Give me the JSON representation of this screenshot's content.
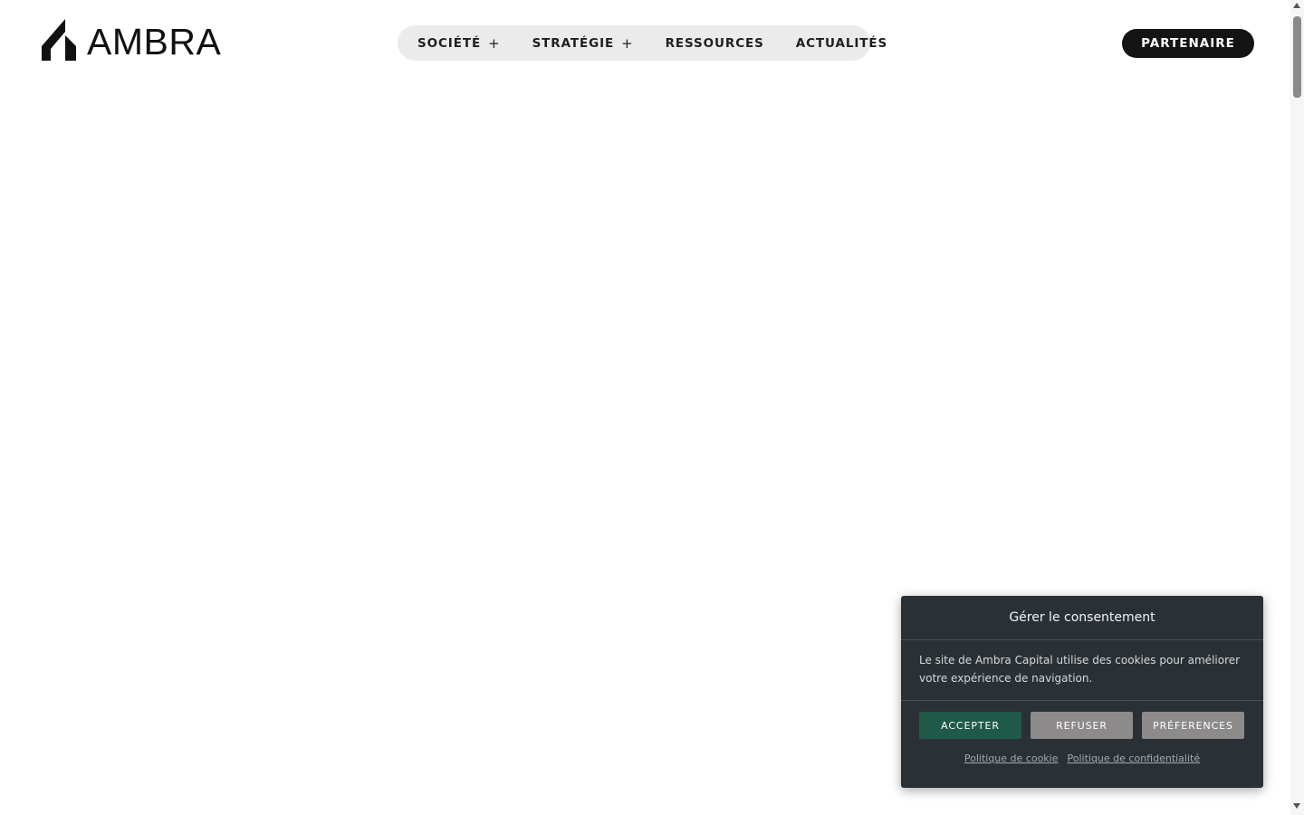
{
  "header": {
    "logo": {
      "text": "AMBRA",
      "icon": "ambra-mark-icon"
    },
    "nav": [
      {
        "label": "SOCIÉTÉ",
        "expand": "+"
      },
      {
        "label": "STRATÉGIE",
        "expand": "+"
      },
      {
        "label": "RESSOURCES"
      },
      {
        "label": "ACTUALITÉS"
      }
    ],
    "partner_label": "PARTENAIRE"
  },
  "cookie": {
    "title": "Gérer le consentement",
    "message": "Le site de Ambra Capital utilise des cookies pour améliorer votre expérience de navigation.",
    "buttons": {
      "accept": "ACCEPTER",
      "refuse": "REFUSER",
      "preferences": "PRÉFERENCES"
    },
    "links": {
      "cookie_policy": "Politique de cookie",
      "privacy_policy": "Politique de confidentialité"
    }
  },
  "colors": {
    "accent_green": "#1f5a48",
    "cookie_bg": "#2a3136",
    "nav_bg": "#ebebeb",
    "partner_bg": "#141414"
  }
}
